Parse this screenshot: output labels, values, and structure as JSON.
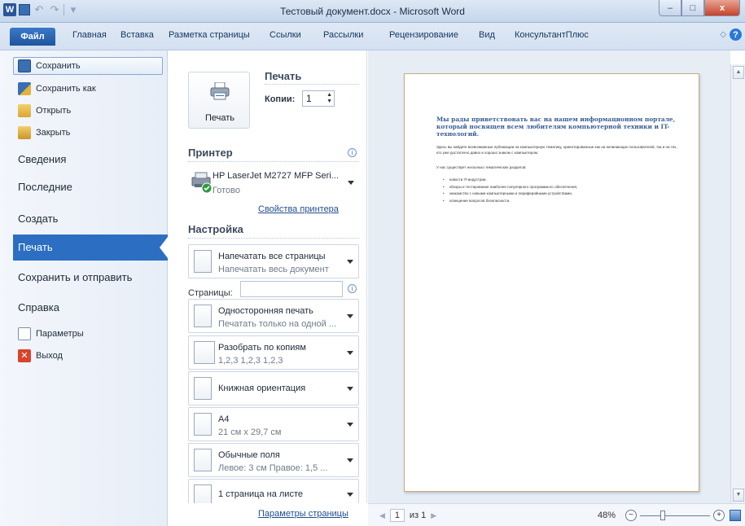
{
  "window": {
    "title": "Тестовый документ.docx - Microsoft Word",
    "minimize": "–",
    "maximize": "□",
    "close": "x"
  },
  "ribbon": {
    "file_tab": "Файл",
    "tabs": [
      "Главная",
      "Вставка",
      "Разметка страницы",
      "Ссылки",
      "Рассылки",
      "Рецензирование",
      "Вид",
      "КонсультантПлюс"
    ],
    "help": "?"
  },
  "nav": {
    "small_items": [
      "Сохранить",
      "Сохранить как",
      "Открыть",
      "Закрыть"
    ],
    "big_items": [
      "Сведения",
      "Последние",
      "Создать",
      "Печать",
      "Сохранить и отправить",
      "Справка"
    ],
    "bottom_items": [
      "Параметры",
      "Выход"
    ],
    "active": "Печать"
  },
  "print": {
    "section_title": "Печать",
    "button_label": "Печать",
    "copies_label": "Копии:",
    "copies_value": "1"
  },
  "printer": {
    "section_title": "Принтер",
    "name": "HP LaserJet M2727 MFP Seri...",
    "status": "Готово",
    "properties_link": "Свойства принтера"
  },
  "settings": {
    "section_title": "Настройка",
    "pages_label": "Страницы:",
    "pages_value": "",
    "items": [
      {
        "main": "Напечатать все страницы",
        "sub": "Напечатать весь документ"
      },
      {
        "main": "Односторонняя печать",
        "sub": "Печатать только на одной ..."
      },
      {
        "main": "Разобрать по копиям",
        "sub": "1,2,3   1,2,3   1,2,3"
      },
      {
        "main": "Книжная ориентация",
        "sub": ""
      },
      {
        "main": "A4",
        "sub": "21 см x 29,7 см"
      },
      {
        "main": "Обычные поля",
        "sub": "Левое: 3 см   Правое: 1,5 ..."
      },
      {
        "main": "1 страница на листе",
        "sub": ""
      }
    ],
    "page_setup_link": "Параметры страницы"
  },
  "document": {
    "heading": "Мы рады приветствовать вас на нашем информационном портале, который посвящен всем любителям компьютерной техники и IT-технологий.",
    "paragraph": "Здесь вы найдете всевозможные публикации на компьютерную тематику, ориентированные как на начинающих пользователей, так и на тех, кто уже достаточно давно и хорошо знаком с компьютером.",
    "intro": "У нас существует несколько тематических разделов:",
    "bullets": [
      "новости IT-индустрии,",
      "обзоры и тестирование наиболее популярного программного обеспечения,",
      "знакомство с новыми компьютерными и периферийными устройствами,",
      "освещение вопросов безопасности."
    ]
  },
  "status": {
    "current_page": "1",
    "of_pages": "из 1",
    "zoom": "48%",
    "zoom_minus": "−",
    "zoom_plus": "+",
    "zoom_level_percent": 48
  },
  "colors": {
    "accent": "#2c6fc2",
    "file_tab": "#1e559e",
    "heading": "#3b5e93",
    "page_border": "#c6aa82"
  },
  "icons": {
    "save": "floppy-icon",
    "save_as": "save-as-icon",
    "open": "folder-open-icon",
    "close": "folder-close-icon",
    "options": "options-icon",
    "exit": "exit-icon",
    "printer": "printer-icon",
    "info": "info-icon"
  }
}
